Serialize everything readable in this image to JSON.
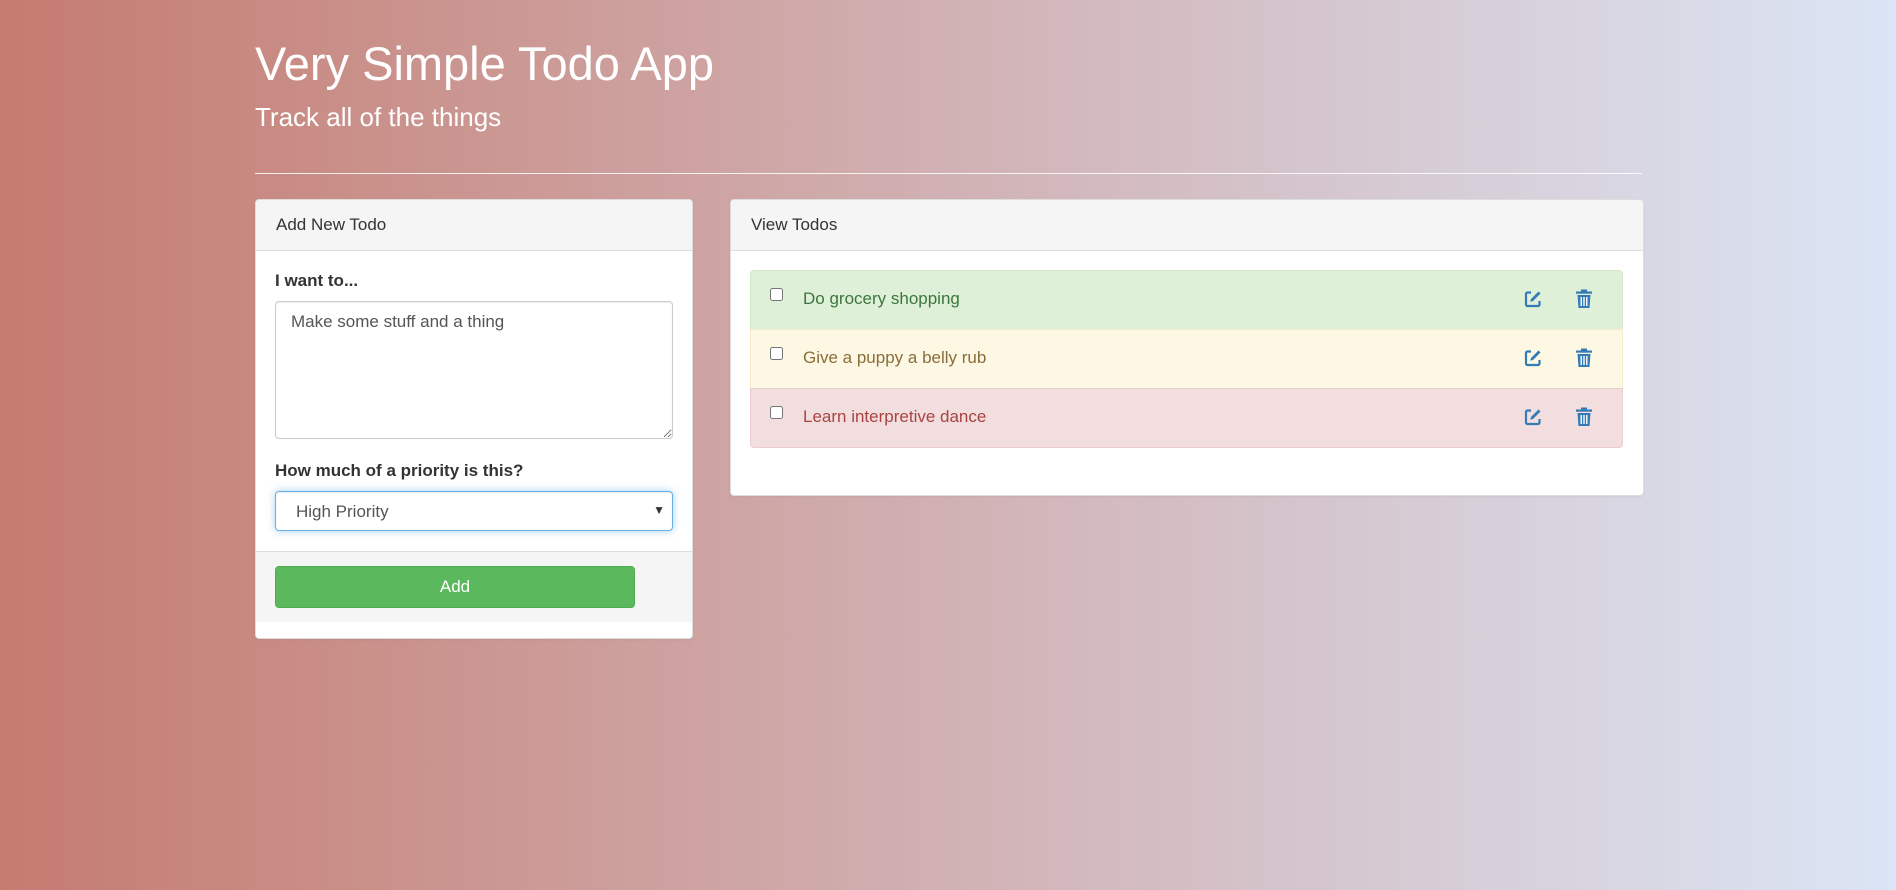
{
  "header": {
    "title": "Very Simple Todo App",
    "subtitle": "Track all of the things"
  },
  "add_panel": {
    "heading": "Add New Todo",
    "todo_label": "I want to...",
    "todo_value": "Make some stuff and a thing",
    "priority_label": "How much of a priority is this?",
    "priority_selected": "High Priority",
    "add_button": "Add"
  },
  "view_panel": {
    "heading": "View Todos",
    "todos": [
      {
        "text": "Do grocery shopping",
        "status": "success",
        "checked": false
      },
      {
        "text": "Give a puppy a belly rub",
        "status": "warning",
        "checked": false
      },
      {
        "text": "Learn interpretive dance",
        "status": "danger",
        "checked": false
      }
    ],
    "icons": {
      "edit": "edit-icon",
      "delete": "trash-icon"
    }
  },
  "colors": {
    "accent_blue": "#337ab7",
    "success_bg": "#dff0d8",
    "warning_bg": "#fcf8e3",
    "danger_bg": "#f2dede",
    "add_button": "#5cb85c"
  }
}
